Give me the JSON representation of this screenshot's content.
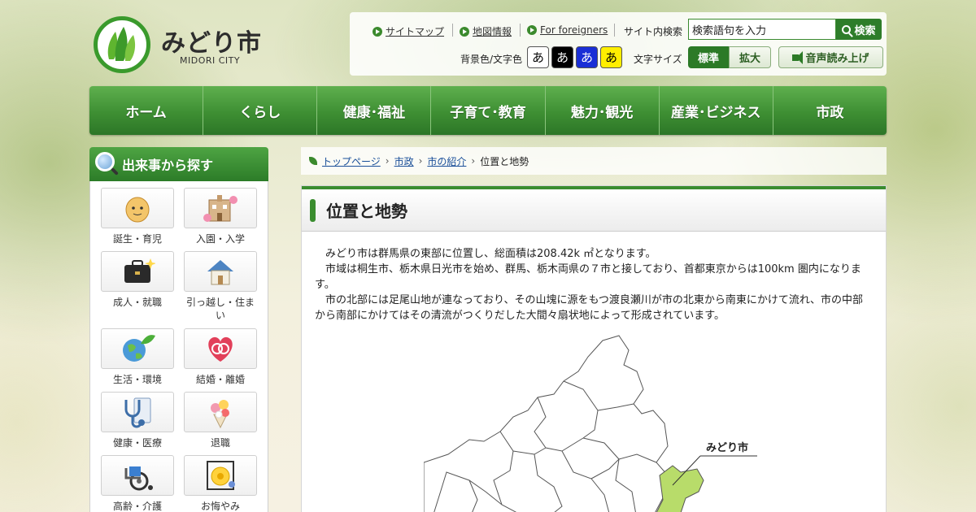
{
  "header": {
    "logo_title": "みどり市",
    "logo_sub": "MIDORI CITY",
    "links": [
      "サイトマップ",
      "地図情報",
      "For foreigners"
    ],
    "search_label": "サイト内検索",
    "search_value": "検索語句を入力",
    "search_button": "検索",
    "color_label": "背景色/文字色",
    "color_options": [
      {
        "glyph": "あ",
        "bg": "#ffffff",
        "fg": "#000000"
      },
      {
        "glyph": "あ",
        "bg": "#000000",
        "fg": "#ffffff"
      },
      {
        "glyph": "あ",
        "bg": "#1a2fd6",
        "fg": "#ffffff"
      },
      {
        "glyph": "あ",
        "bg": "#ffee00",
        "fg": "#000000"
      }
    ],
    "size_label": "文字サイズ",
    "size_standard": "標準",
    "size_large": "拡大",
    "voice_button": "音声読み上げ"
  },
  "nav": [
    "ホーム",
    "くらし",
    "健康･福祉",
    "子育て･教育",
    "魅力･観光",
    "産業･ビジネス",
    "市政"
  ],
  "sidebar": {
    "title": "出来事から探す",
    "items": [
      {
        "label": "誕生・育児",
        "icon": "baby-icon"
      },
      {
        "label": "入園・入学",
        "icon": "school-icon"
      },
      {
        "label": "成人・就職",
        "icon": "briefcase-icon"
      },
      {
        "label": "引っ越し・住まい",
        "icon": "house-icon"
      },
      {
        "label": "生活・環境",
        "icon": "globe-leaf-icon"
      },
      {
        "label": "結婚・離婚",
        "icon": "rings-icon"
      },
      {
        "label": "健康・医療",
        "icon": "stethoscope-icon"
      },
      {
        "label": "退職",
        "icon": "bouquet-icon"
      },
      {
        "label": "高齢・介護",
        "icon": "wheelchair-icon"
      },
      {
        "label": "お悔やみ",
        "icon": "chrysanthemum-icon"
      }
    ]
  },
  "breadcrumb": {
    "items": [
      "トップページ",
      "市政",
      "市の紹介"
    ],
    "current": "位置と地勢"
  },
  "page": {
    "title": "位置と地勢",
    "paragraphs": [
      "　みどり市は群馬県の東部に位置し、総面積は208.42k ㎡となります。",
      "　市域は桐生市、栃木県日光市を始め、群馬、栃木両県の７市と接しており、首都東京からは100km 圏内になります。",
      "　市の北部には足尾山地が連なっており、その山塊に源をもつ渡良瀬川が市の北東から南東にかけて流れ、市の中部から南部にかけてはその清流がつくりだした大間々扇状地によって形成されています。"
    ],
    "map_label": "みどり市",
    "highlight_color": "#b8dc6a"
  }
}
